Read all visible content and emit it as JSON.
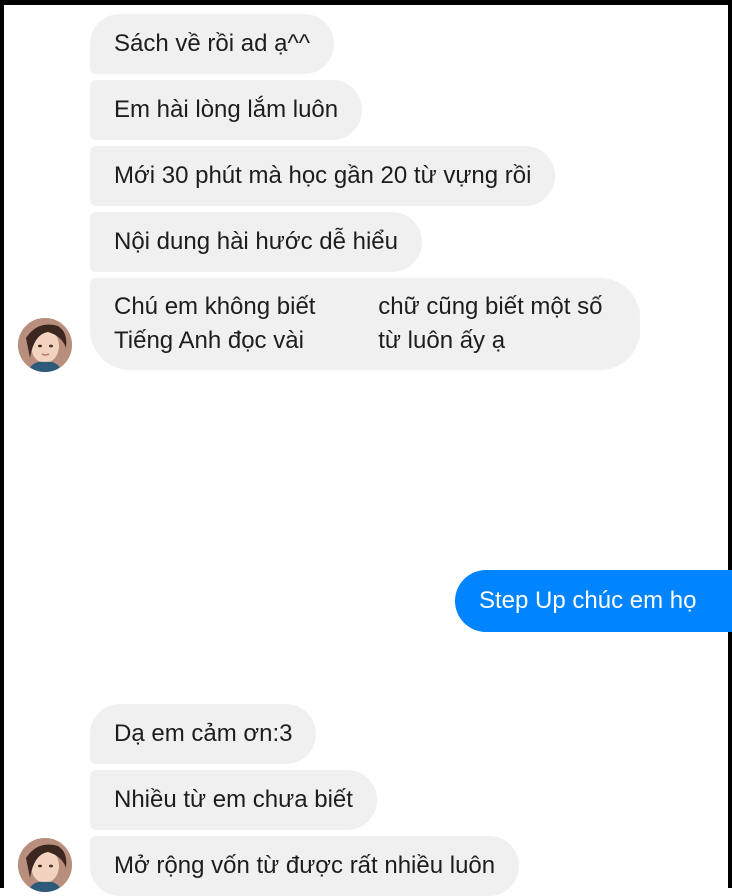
{
  "colors": {
    "incoming_bubble": "#f1f0f0",
    "outgoing_bubble": "#0084ff",
    "incoming_text": "#1d1d1d",
    "outgoing_text": "#ffffff"
  },
  "conversation": {
    "group1": {
      "messages": [
        "Sách về rồi ad ạ^^",
        "Em hài lòng lắm luôn",
        "Mới 30 phút mà học gần 20 từ vựng rồi",
        "Nội dung hài hước dễ hiểu"
      ],
      "last_message_lines": [
        "Chú em không biết Tiếng Anh đọc vài",
        "chữ cũng biết một số từ luôn ấy ạ"
      ],
      "avatar_icon": "user-avatar-icon"
    },
    "outgoing": {
      "text": "Step Up chúc em họ"
    },
    "group2": {
      "messages": [
        "Dạ em cảm ơn:3",
        "Nhiều từ em chưa biết",
        "Mở rộng vốn từ được rất nhiều luôn"
      ],
      "avatar_icon": "user-avatar-icon"
    }
  }
}
